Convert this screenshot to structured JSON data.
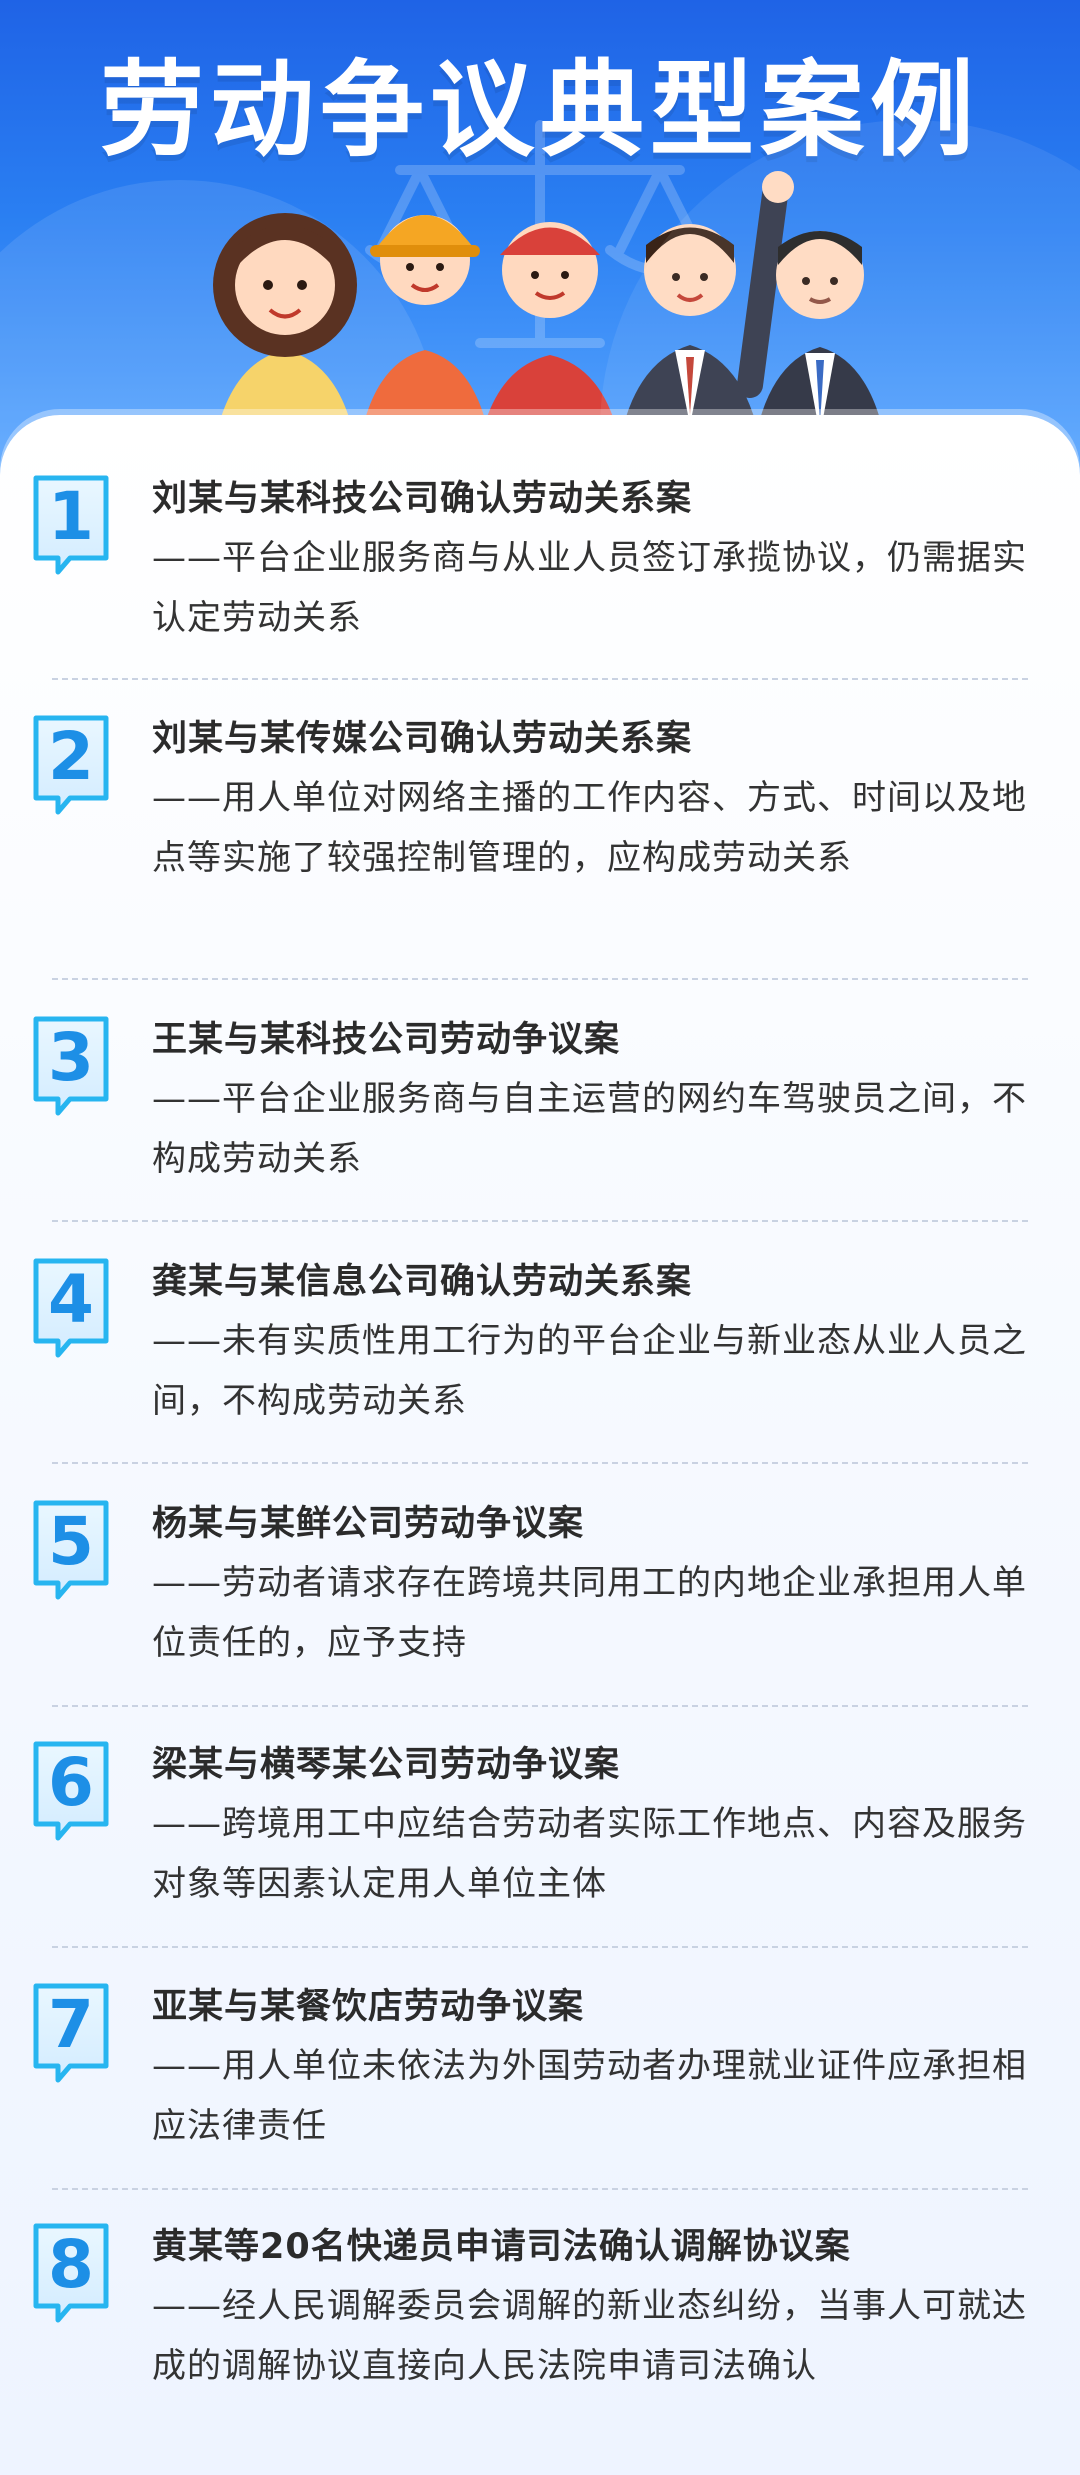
{
  "title": "劳动争议典型案例",
  "colors": {
    "accent": "#1f63e6",
    "badge_fill": "#2a7ff2",
    "text_dark": "#2b2b2b"
  },
  "icons": {
    "badge": "speech-bubble-number-badge",
    "illustration": "workers-and-professionals-illustration",
    "scale": "justice-scale-icon"
  },
  "cases": [
    {
      "number": "1",
      "title": "刘某与某科技公司确认劳动关系案",
      "desc": "——平台企业服务商与从业人员签订承揽协议，仍需据实认定劳动关系"
    },
    {
      "number": "2",
      "title": "刘某与某传媒公司确认劳动关系案",
      "desc": "——用人单位对网络主播的工作内容、方式、时间以及地点等实施了较强控制管理的，应构成劳动关系"
    },
    {
      "number": "3",
      "title": "王某与某科技公司劳动争议案",
      "desc": "——平台企业服务商与自主运营的网约车驾驶员之间，不构成劳动关系"
    },
    {
      "number": "4",
      "title": "龚某与某信息公司确认劳动关系案",
      "desc": "——未有实质性用工行为的平台企业与新业态从业人员之间，不构成劳动关系"
    },
    {
      "number": "5",
      "title": "杨某与某鲜公司劳动争议案",
      "desc": "——劳动者请求存在跨境共同用工的内地企业承担用人单位责任的，应予支持"
    },
    {
      "number": "6",
      "title": "梁某与横琴某公司劳动争议案",
      "desc": "——跨境用工中应结合劳动者实际工作地点、内容及服务对象等因素认定用人单位主体"
    },
    {
      "number": "7",
      "title": "亚某与某餐饮店劳动争议案",
      "desc": "——用人单位未依法为外国劳动者办理就业证件应承担相应法律责任"
    },
    {
      "number": "8",
      "title": "黄某等20名快递员申请司法确认调解协议案",
      "desc": "——经人民调解委员会调解的新业态纠纷，当事人可就达成的调解协议直接向人民法院申请司法确认"
    }
  ]
}
